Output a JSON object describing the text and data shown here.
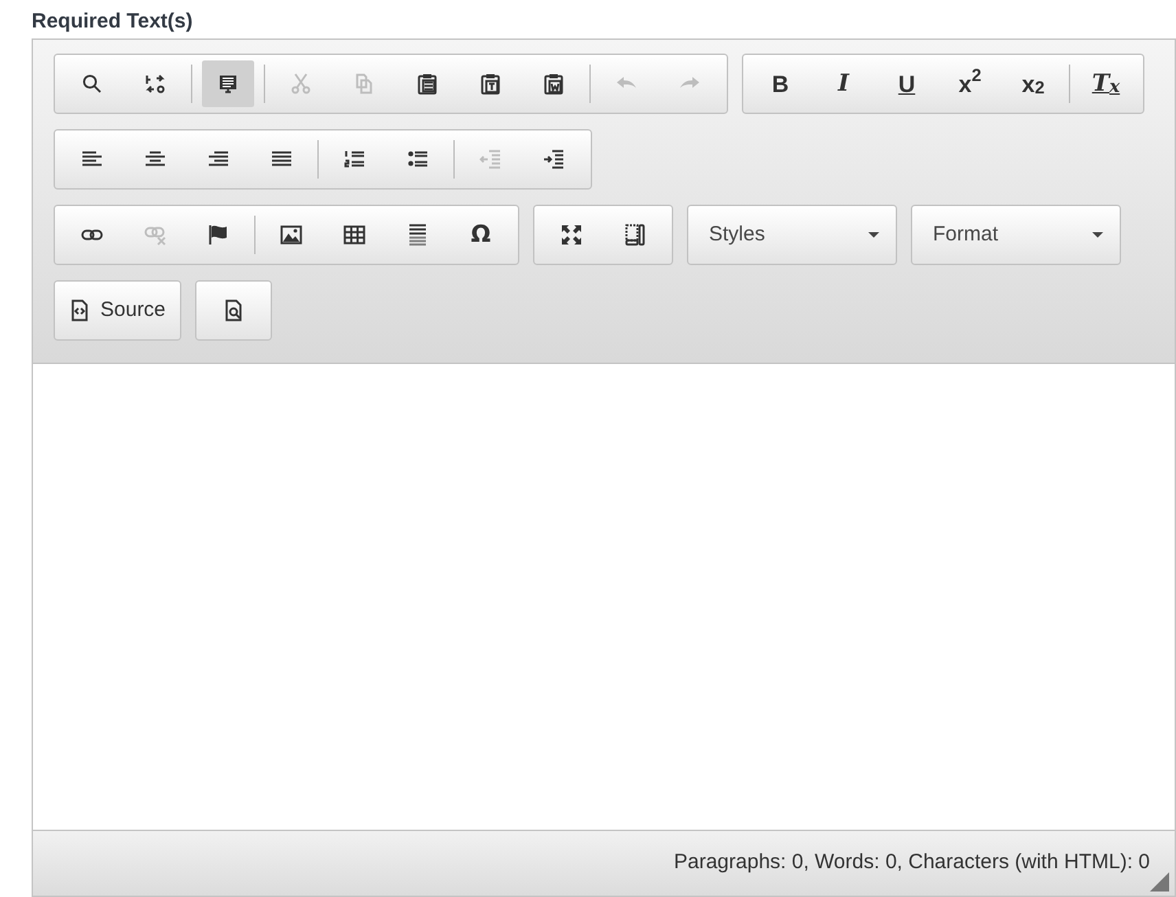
{
  "label": "Required Text(s)",
  "toolbar": {
    "rows": [
      [
        {
          "kind": "buttons",
          "items": [
            {
              "kind": "icon",
              "disabled": false,
              "on": false
            },
            {
              "kind": "icon",
              "disabled": false,
              "on": false
            },
            {
              "kind": "separator"
            },
            {
              "kind": "icon",
              "disabled": false,
              "on": true
            },
            {
              "kind": "separator"
            },
            {
              "kind": "icon",
              "disabled": true,
              "on": false
            },
            {
              "kind": "icon",
              "disabled": true,
              "on": false
            },
            {
              "kind": "icon",
              "disabled": false,
              "on": false
            },
            {
              "kind": "icon",
              "disabled": false,
              "on": false
            },
            {
              "kind": "icon",
              "disabled": false,
              "on": false
            },
            {
              "kind": "separator"
            },
            {
              "kind": "icon",
              "disabled": true,
              "on": false
            },
            {
              "kind": "icon",
              "disabled": true,
              "on": false
            }
          ]
        },
        {
          "kind": "buttons",
          "items": [
            {
              "kind": "glyph",
              "text": "B",
              "disabled": false,
              "on": false
            },
            {
              "kind": "glyph",
              "text": "I",
              "disabled": false,
              "on": false
            },
            {
              "kind": "glyph",
              "text": "U",
              "disabled": false,
              "on": false
            },
            {
              "kind": "glyph",
              "text": "x$^{2}$",
              "disabled": false,
              "on": false
            },
            {
              "kind": "glyph",
              "text": "x$_{2}$",
              "disabled": false,
              "on": false
            },
            {
              "kind": "separator"
            },
            {
              "kind": "glyph",
              "text": "T$_{x}$",
              "disabled": false,
              "on": false
            }
          ]
        }
      ],
      [
        {
          "kind": "buttons",
          "items": [
            {
              "kind": "icon",
              "disabled": false,
              "on": false
            },
            {
              "kind": "icon",
              "disabled": false,
              "on": false
            },
            {
              "kind": "icon",
              "disabled": false,
              "on": false
            },
            {
              "kind": "icon",
              "disabled": false,
              "on": false
            },
            {
              "kind": "separator"
            },
            {
              "kind": "icon",
              "disabled": false,
              "on": false
            },
            {
              "kind": "icon",
              "disabled": false,
              "on": false
            },
            {
              "kind": "separator"
            },
            {
              "kind": "icon",
              "disabled": true,
              "on": false
            },
            {
              "kind": "icon",
              "disabled": false,
              "on": false
            }
          ]
        }
      ],
      [
        {
          "kind": "buttons",
          "items": [
            {
              "kind": "icon",
              "disabled": false,
              "on": false
            },
            {
              "kind": "icon",
              "disabled": true,
              "on": false
            },
            {
              "kind": "icon",
              "disabled": false,
              "on": false
            },
            {
              "kind": "separator"
            },
            {
              "kind": "icon",
              "disabled": false,
              "on": false
            },
            {
              "kind": "icon",
              "disabled": false,
              "on": false
            },
            {
              "kind": "icon",
              "disabled": false,
              "on": false
            },
            {
              "kind": "glyph",
              "text": "Ω",
              "disabled": false,
              "on": false
            }
          ]
        },
        {
          "kind": "buttons",
          "items": [
            {
              "kind": "icon",
              "disabled": false,
              "on": false
            },
            {
              "kind": "icon",
              "disabled": false,
              "on": false
            }
          ]
        },
        {
          "kind": "combo",
          "label": "Styles"
        },
        {
          "kind": "combo",
          "label": "Format"
        }
      ],
      [
        {
          "kind": "buttons",
          "items": [
            {
              "kind": "labeled",
              "label": "Source",
              "disabled": false,
              "on": false
            }
          ]
        },
        {
          "kind": "buttons",
          "items": [
            {
              "kind": "icon",
              "disabled": false,
              "on": false
            }
          ]
        }
      ]
    ]
  },
  "status_bar": "Paragraphs: 0, Words: 0, Characters (with HTML): 0"
}
